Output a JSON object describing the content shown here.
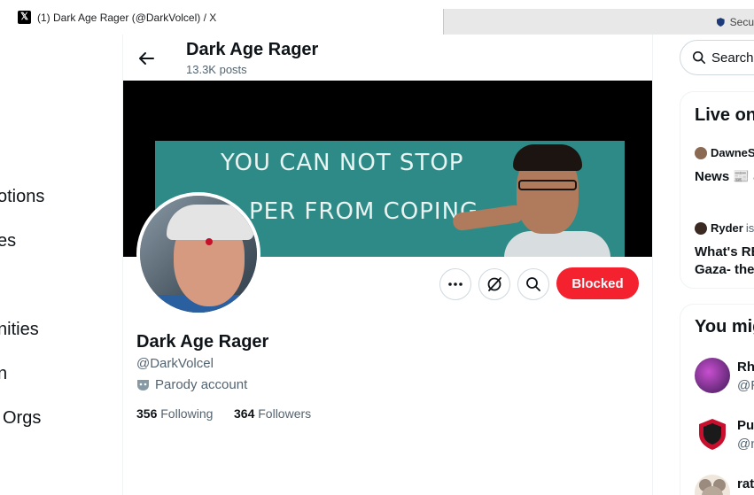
{
  "browser": {
    "active_tab_title": "(1) Dark Age Rager (@DarkVolcel) / X",
    "inactive_tab_title": "Secu"
  },
  "leftnav": {
    "items": [
      "otions",
      "es",
      "nities",
      "n",
      "Orgs"
    ]
  },
  "header": {
    "name": "Dark Age Rager",
    "posts": "13.3K posts"
  },
  "banner": {
    "line1": "YOU CAN NOT STOP",
    "line2": "PER FROM COPING"
  },
  "profile": {
    "name": "Dark Age Rager",
    "handle": "@DarkVolcel",
    "label": "Parody account",
    "following_count": "356",
    "following_label": "Following",
    "followers_count": "364",
    "followers_label": "Followers",
    "blocked_label": "Blocked"
  },
  "right": {
    "search_label": "Search",
    "live_title": "Live on",
    "live_items": [
      {
        "user": "DawneS",
        "text": "News 📰 a"
      },
      {
        "user": "Ryder",
        "suffix": "is",
        "text1": "What's RE",
        "text2": "Gaza- the"
      }
    ],
    "suggest_title": "You mig",
    "suggestions": [
      {
        "name": "Rh",
        "handle": "@R"
      },
      {
        "name": "Pu",
        "handle": "@n"
      },
      {
        "name": "rat",
        "handle": ""
      }
    ]
  },
  "colors": {
    "blocked": "#f4212e",
    "text_secondary": "#536471"
  }
}
